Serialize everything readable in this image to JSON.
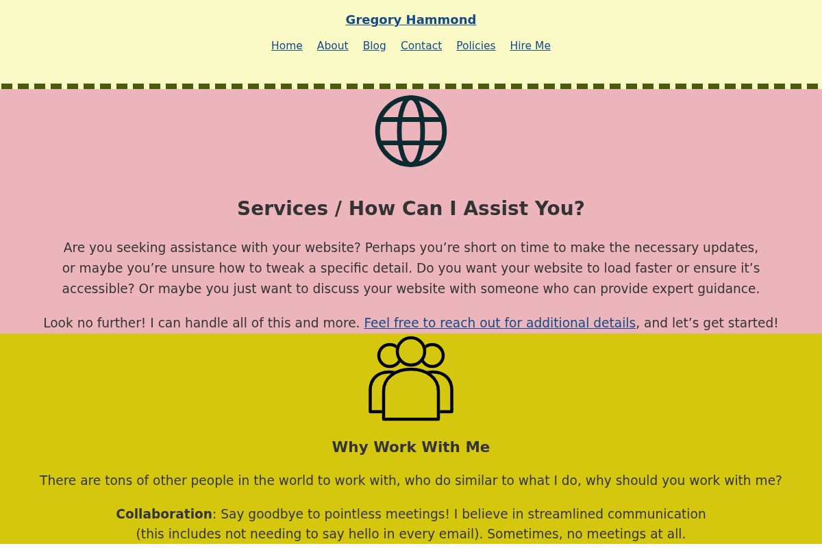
{
  "header": {
    "site_title": "Gregory Hammond",
    "nav": [
      "Home",
      "About",
      "Blog",
      "Contact",
      "Policies",
      "Hire Me"
    ]
  },
  "services": {
    "heading": "Services / How Can I Assist You?",
    "paragraphs": [
      "Are you seeking assistance with your website? Perhaps you’re short on time to make the necessary updates, or maybe you’re unsure how to tweak a specific detail. Do you want your website to load faster or ensure it’s accessible? Or maybe you just want to discuss your website with someone who can provide expert guidance."
    ],
    "closing": {
      "before": "Look no further! I can handle all of this and more. ",
      "link": "Feel free to reach out for additional details",
      "after": ", and let’s get started!"
    }
  },
  "why_work_with_me": {
    "heading": "Why Work With Me",
    "paragraphs": [
      "There are tons of other people in the world to work with, who do similar to what I do, why should you work with me?",
      "**Collaboration**: Say goodbye to pointless meetings! I believe in streamlined communication (this includes not needing to say hello in every email). Sometimes, no meetings at all."
    ]
  }
}
